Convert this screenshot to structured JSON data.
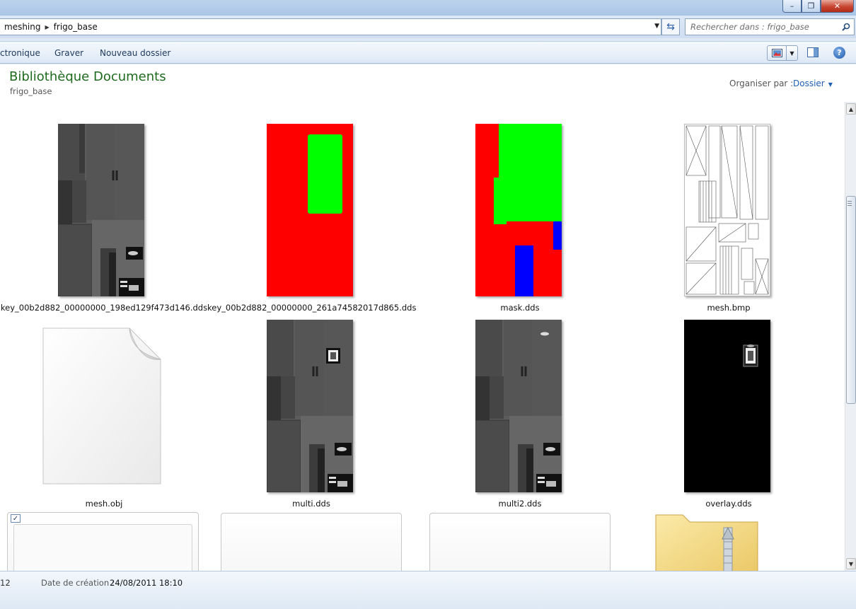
{
  "window": {
    "minimize_glyph": "–",
    "maximize_glyph": "❐",
    "close_glyph": "✕"
  },
  "address": {
    "crumbs": [
      "meshing",
      "frigo_base"
    ],
    "search_placeholder": "Rechercher dans : frigo_base"
  },
  "commands": {
    "items": [
      "ctronique",
      "Graver",
      "Nouveau dossier"
    ]
  },
  "library": {
    "title": "Bibliothèque Documents",
    "subtitle": "frigo_base",
    "organize_label": "Organiser par :",
    "organize_value": "Dossier"
  },
  "files": [
    {
      "name": "key_00b2d882_00000000_198ed129f473d146.dds",
      "kind": "gray-texture"
    },
    {
      "name": "key_00b2d882_00000000_261a74582017d865.dds",
      "kind": "red-green"
    },
    {
      "name": "mask.dds",
      "kind": "mask"
    },
    {
      "name": "mesh.bmp",
      "kind": "wireframe"
    },
    {
      "name": "mesh.obj",
      "kind": "document"
    },
    {
      "name": "multi.dds",
      "kind": "gray-texture-dispenser"
    },
    {
      "name": "multi2.dds",
      "kind": "gray-texture-dispenser-light"
    },
    {
      "name": "overlay.dds",
      "kind": "black-dispenser"
    }
  ],
  "bottom_row": {
    "checkbox_glyph": "✓",
    "zip_folder_icon": "zip-folder-icon"
  },
  "details": {
    "count": "12",
    "created_label": "Date de création :",
    "created_value": "24/08/2011 18:10"
  },
  "colors": {
    "title_green": "#1e6b1e",
    "link_blue": "#1f5eb2",
    "mask_red": "#ff0000",
    "mask_green": "#00ff00",
    "mask_blue": "#0000ff"
  }
}
